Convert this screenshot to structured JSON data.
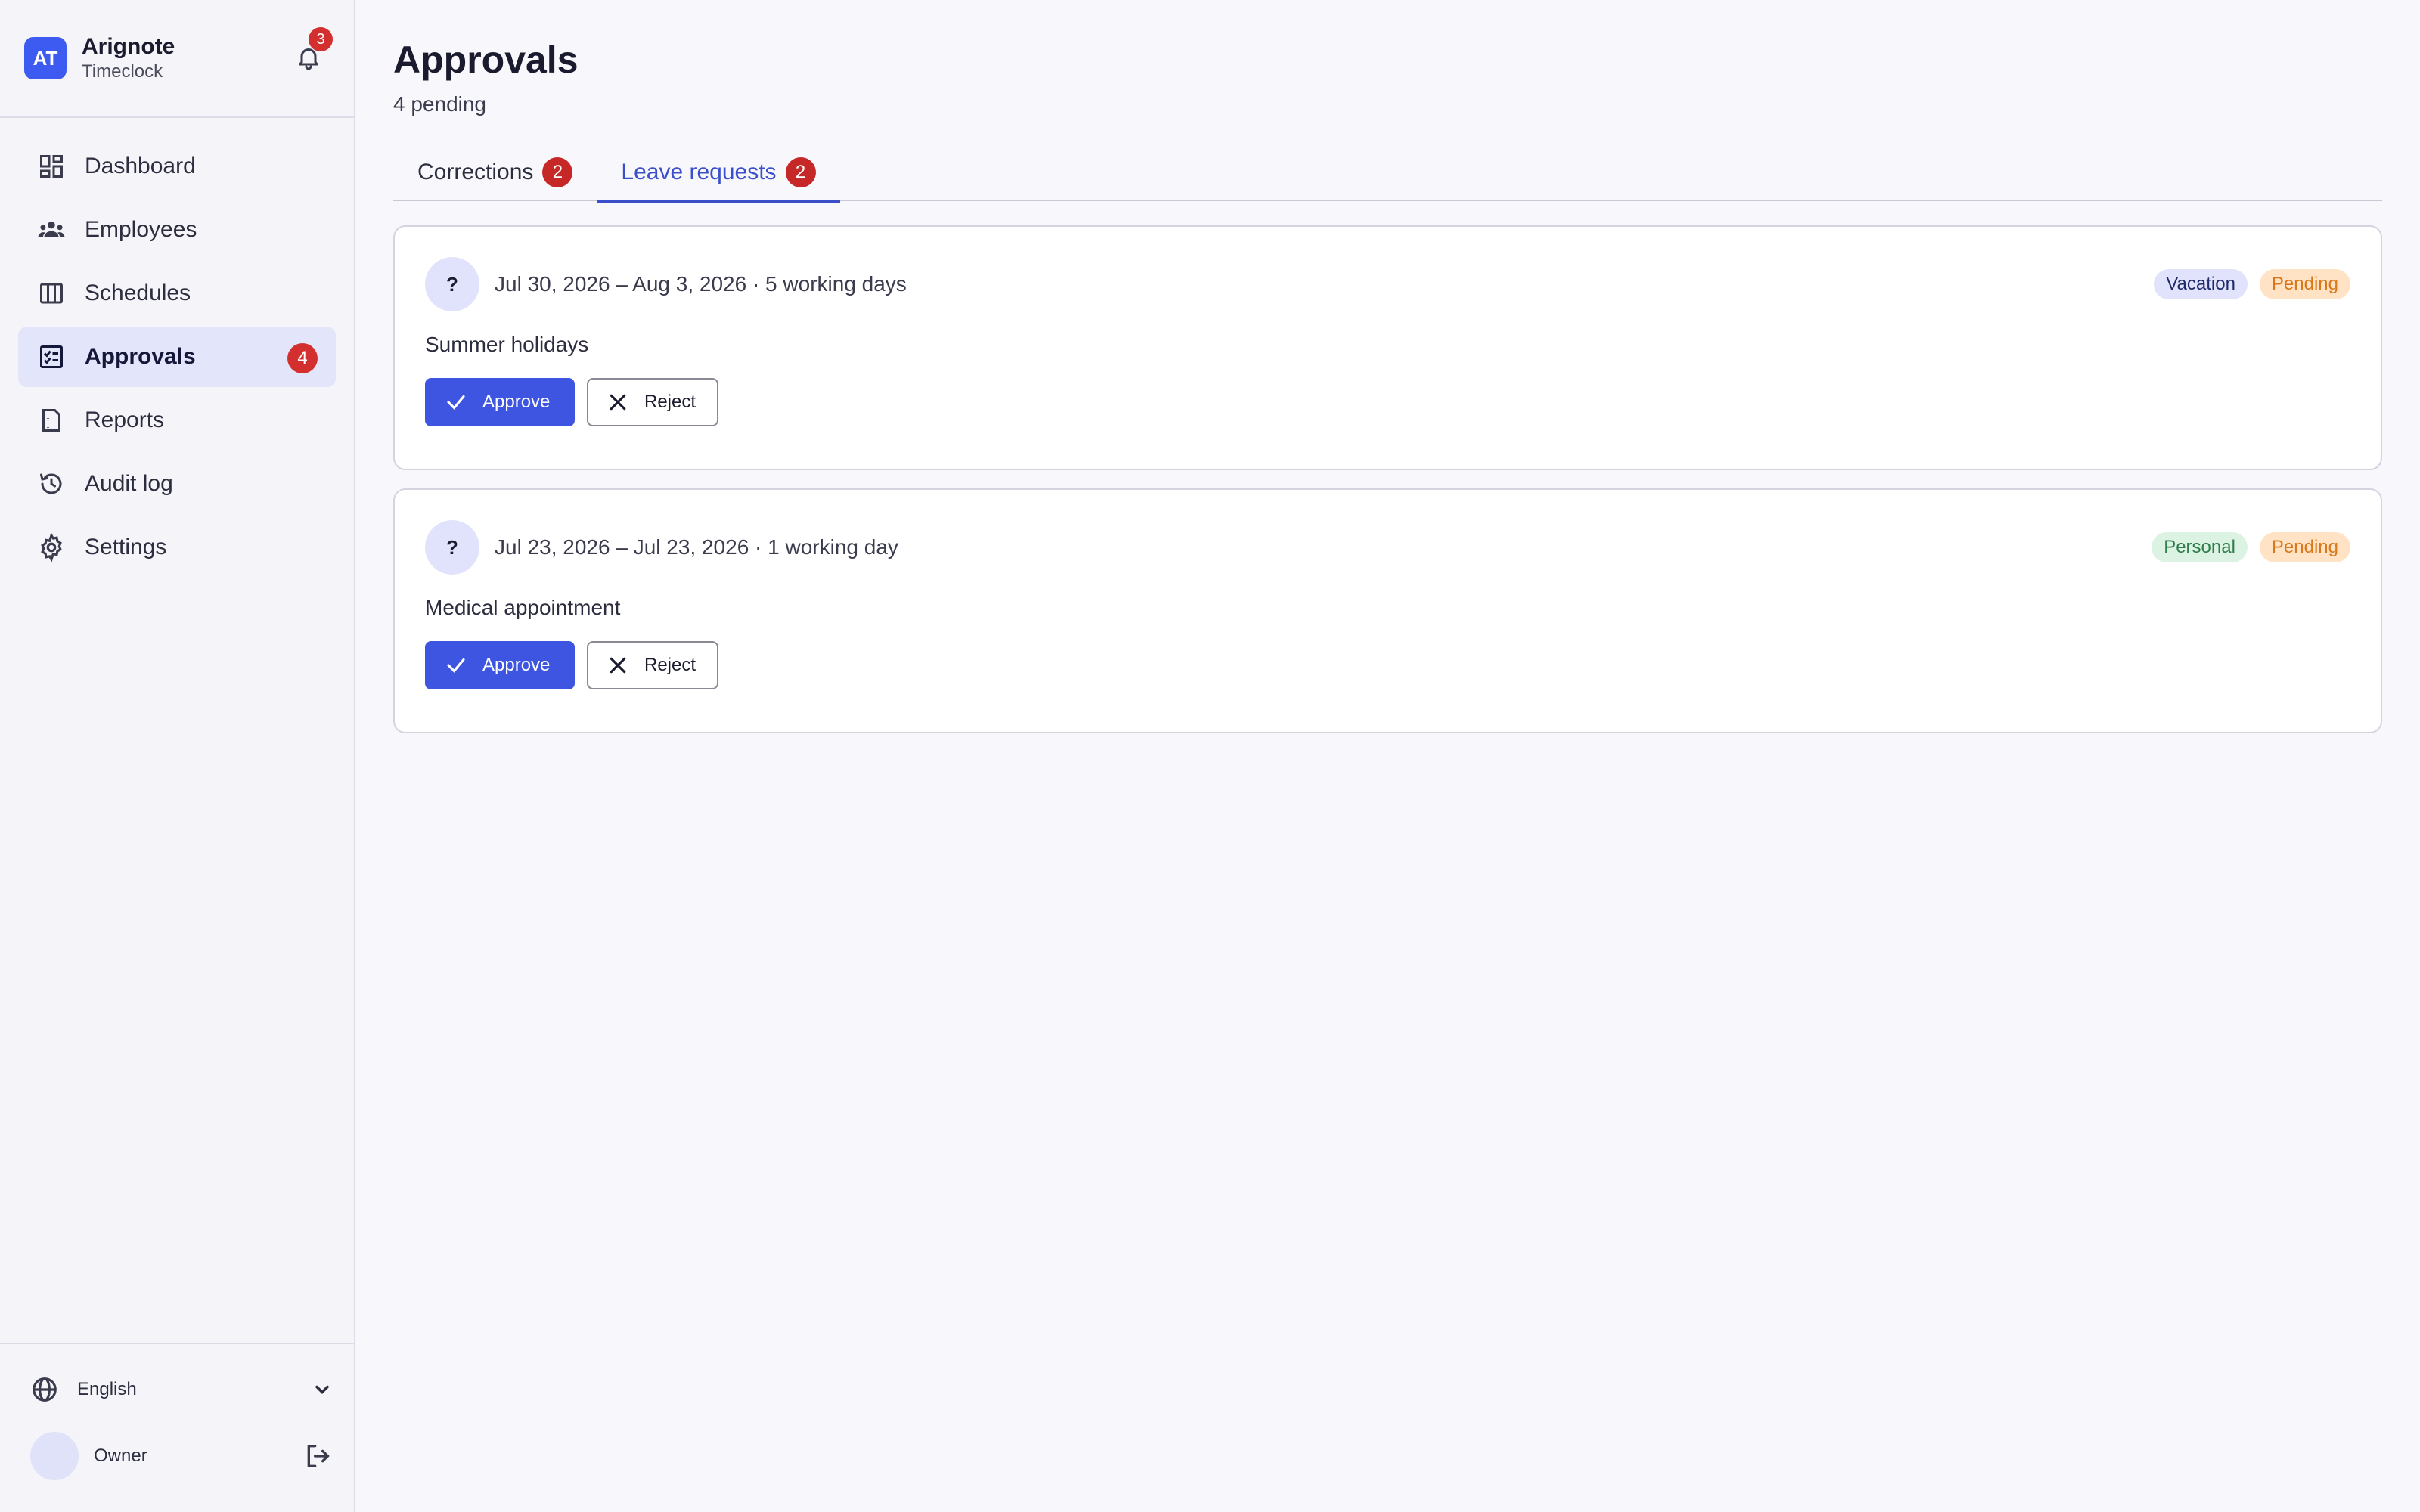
{
  "brand": {
    "logo_text": "AT",
    "name": "Arignote",
    "subtitle": "Timeclock",
    "notification_count": "3"
  },
  "sidebar": {
    "items": [
      {
        "label": "Dashboard",
        "icon": "dashboard-icon"
      },
      {
        "label": "Employees",
        "icon": "people-icon"
      },
      {
        "label": "Schedules",
        "icon": "calendar-grid-icon"
      },
      {
        "label": "Approvals",
        "icon": "checklist-icon",
        "badge": "4",
        "active": true
      },
      {
        "label": "Reports",
        "icon": "report-icon"
      },
      {
        "label": "Audit log",
        "icon": "history-icon"
      },
      {
        "label": "Settings",
        "icon": "gear-icon"
      }
    ],
    "language": "English",
    "user_role": "Owner"
  },
  "page": {
    "title": "Approvals",
    "subtitle": "4 pending"
  },
  "tabs": [
    {
      "label": "Corrections",
      "count": "2",
      "active": false
    },
    {
      "label": "Leave requests",
      "count": "2",
      "active": true
    }
  ],
  "requests": [
    {
      "avatar": "?",
      "dates": "Jul 30, 2026 – Aug 3, 2026 · 5 working days",
      "type": "Vacation",
      "status": "Pending",
      "reason": "Summer holidays",
      "approve_label": "Approve",
      "reject_label": "Reject"
    },
    {
      "avatar": "?",
      "dates": "Jul 23, 2026 – Jul 23, 2026 · 1 working day",
      "type": "Personal",
      "status": "Pending",
      "reason": "Medical appointment",
      "approve_label": "Approve",
      "reject_label": "Reject"
    }
  ],
  "colors": {
    "accent": "#3d55e0",
    "badge": "#d32f2f",
    "pending": "#d9781a",
    "personal": "#2e7d4a"
  }
}
